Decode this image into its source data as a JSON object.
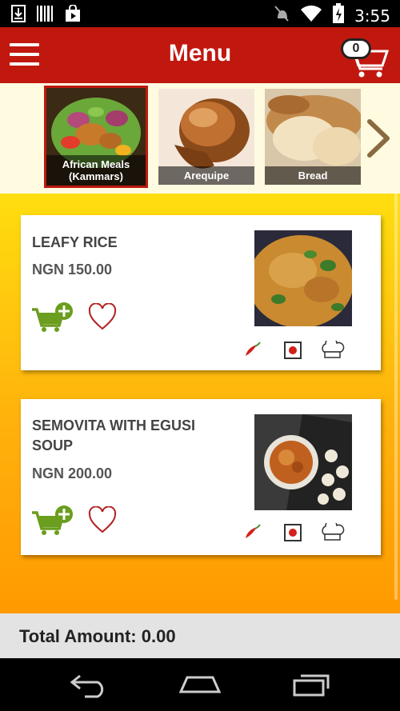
{
  "status_bar": {
    "time": "3:55",
    "icons": [
      "download-icon",
      "barcode-icon",
      "play-store-icon",
      "mute-icon",
      "wifi-icon",
      "battery-icon"
    ]
  },
  "app_bar": {
    "title": "Menu",
    "cart_count": "0"
  },
  "categories": [
    {
      "label": "African Meals (Kammars)",
      "selected": true
    },
    {
      "label": "Arequipe",
      "selected": false
    },
    {
      "label": "Bread",
      "selected": false
    }
  ],
  "items": [
    {
      "name": "LEAFY RICE",
      "price": "NGN 150.00"
    },
    {
      "name": "SEMOVITA WITH EGUSI SOUP",
      "price": "NGN 200.00"
    }
  ],
  "attribute_icons": [
    "chili-icon",
    "non-veg-icon",
    "chef-hat-icon"
  ],
  "footer": {
    "total_label": "Total Amount: 0.00"
  },
  "colors": {
    "brand_red": "#c0180f",
    "accent_green": "#6b9d1e",
    "gradient_top": "#ffde0f",
    "gradient_bottom": "#ff9a00"
  }
}
